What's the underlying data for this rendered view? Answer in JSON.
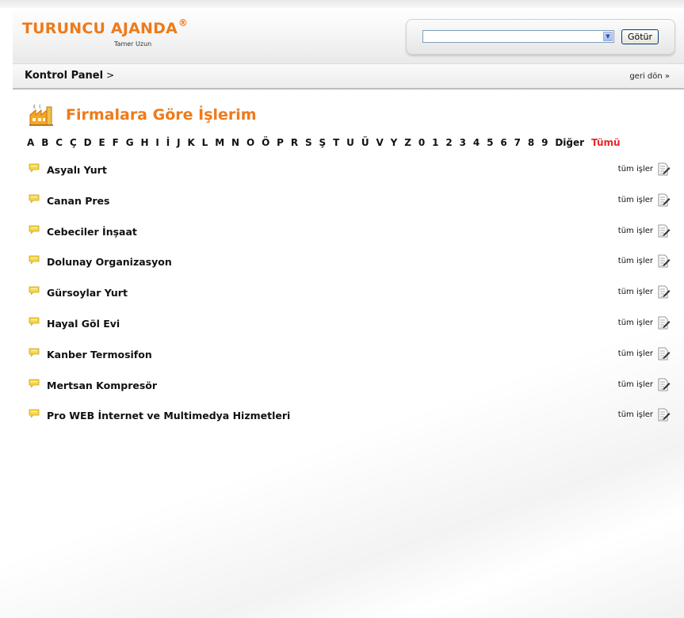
{
  "header": {
    "logo_text": "TURUNCU AJANDA",
    "logo_reg": "®",
    "logo_author": "Tamer Uzun",
    "search_select_value": "",
    "go_button_label": "Götür"
  },
  "breadcrumb": {
    "title": "Kontrol Panel",
    "separator": ">",
    "back_label": "geri dön »"
  },
  "main": {
    "title": "Firmalara Göre İşlerim",
    "letters": [
      "A",
      "B",
      "C",
      "Ç",
      "D",
      "E",
      "F",
      "G",
      "H",
      "I",
      "İ",
      "J",
      "K",
      "L",
      "M",
      "N",
      "O",
      "Ö",
      "P",
      "R",
      "S",
      "Ş",
      "T",
      "U",
      "Ü",
      "V",
      "Y",
      "Z",
      "0",
      "1",
      "2",
      "3",
      "4",
      "5",
      "6",
      "7",
      "8",
      "9",
      "Diğer",
      "Tümü"
    ],
    "active_letter": "Tümü",
    "companies": [
      {
        "name": "Asyalı Yurt",
        "link": "tüm işler"
      },
      {
        "name": "Canan Pres",
        "link": "tüm işler"
      },
      {
        "name": "Cebeciler İnşaat",
        "link": "tüm işler"
      },
      {
        "name": "Dolunay Organizasyon",
        "link": "tüm işler"
      },
      {
        "name": "Gürsoylar Yurt",
        "link": "tüm işler"
      },
      {
        "name": "Hayal Göl Evi",
        "link": "tüm işler"
      },
      {
        "name": "Kanber Termosifon",
        "link": "tüm işler"
      },
      {
        "name": "Mertsan Kompresör",
        "link": "tüm işler"
      },
      {
        "name": "Pro WEB İnternet ve Multimedya Hizmetleri",
        "link": "tüm işler"
      }
    ]
  },
  "icons": {
    "title_icon": "factory-icon",
    "row_icon": "speech-bubble-icon",
    "edit_icon": "edit-note-icon"
  },
  "colors": {
    "accent": "#ee7a1a",
    "active_letter": "#e8262c"
  }
}
